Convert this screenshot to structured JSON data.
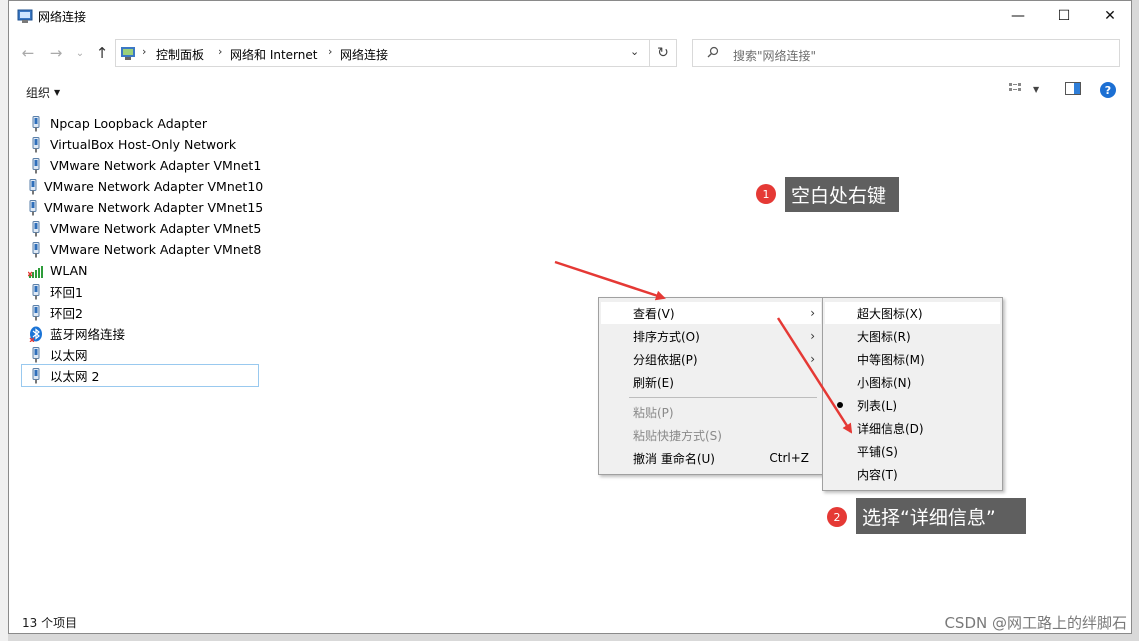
{
  "window": {
    "title": "网络连接"
  },
  "nav": {
    "breadcrumbs": [
      "控制面板",
      "网络和 Internet",
      "网络连接"
    ],
    "search_placeholder": "搜索\"网络连接\""
  },
  "toolbar": {
    "organize_label": "组织"
  },
  "files": [
    {
      "name": "Npcap Loopback Adapter",
      "icon": "network-adapter-icon"
    },
    {
      "name": "VirtualBox Host-Only Network",
      "icon": "network-adapter-icon"
    },
    {
      "name": "VMware Network Adapter VMnet1",
      "icon": "network-adapter-icon"
    },
    {
      "name": "VMware Network Adapter VMnet10",
      "icon": "network-adapter-icon"
    },
    {
      "name": "VMware Network Adapter VMnet15",
      "icon": "network-adapter-icon"
    },
    {
      "name": "VMware Network Adapter VMnet5",
      "icon": "network-adapter-icon"
    },
    {
      "name": "VMware Network Adapter VMnet8",
      "icon": "network-adapter-icon"
    },
    {
      "name": "WLAN",
      "icon": "wifi-signal-icon"
    },
    {
      "name": "环回1",
      "icon": "network-adapter-icon"
    },
    {
      "name": "环回2",
      "icon": "network-adapter-icon"
    },
    {
      "name": "蓝牙网络连接",
      "icon": "bluetooth-icon"
    },
    {
      "name": "以太网",
      "icon": "network-adapter-icon"
    },
    {
      "name": "以太网 2",
      "icon": "network-adapter-icon"
    }
  ],
  "status": {
    "item_count": "13 个项目"
  },
  "context_menu": {
    "items": [
      {
        "label": "查看(V)",
        "has_submenu": true
      },
      {
        "label": "排序方式(O)",
        "has_submenu": true
      },
      {
        "label": "分组依据(P)",
        "has_submenu": true
      },
      {
        "label": "刷新(E)"
      },
      {
        "label": "粘贴(P)",
        "disabled": true
      },
      {
        "label": "粘贴快捷方式(S)",
        "disabled": true
      },
      {
        "label": "撤消 重命名(U)",
        "shortcut": "Ctrl+Z"
      }
    ]
  },
  "view_submenu": {
    "items": [
      {
        "label": "超大图标(X)"
      },
      {
        "label": "大图标(R)"
      },
      {
        "label": "中等图标(M)"
      },
      {
        "label": "小图标(N)"
      },
      {
        "label": "列表(L)",
        "selected": true
      },
      {
        "label": "详细信息(D)"
      },
      {
        "label": "平铺(S)"
      },
      {
        "label": "内容(T)"
      }
    ]
  },
  "annotations": {
    "step1": {
      "number": "1",
      "text": "空白处右键"
    },
    "step2": {
      "number": "2",
      "text": "选择“详细信息”"
    }
  },
  "watermark": "CSDN @网工路上的绊脚石",
  "colors": {
    "accent": "#1c6fd3",
    "callout_bg": "#5f5f5f",
    "badge": "#e53935",
    "arrow": "#e53935"
  }
}
